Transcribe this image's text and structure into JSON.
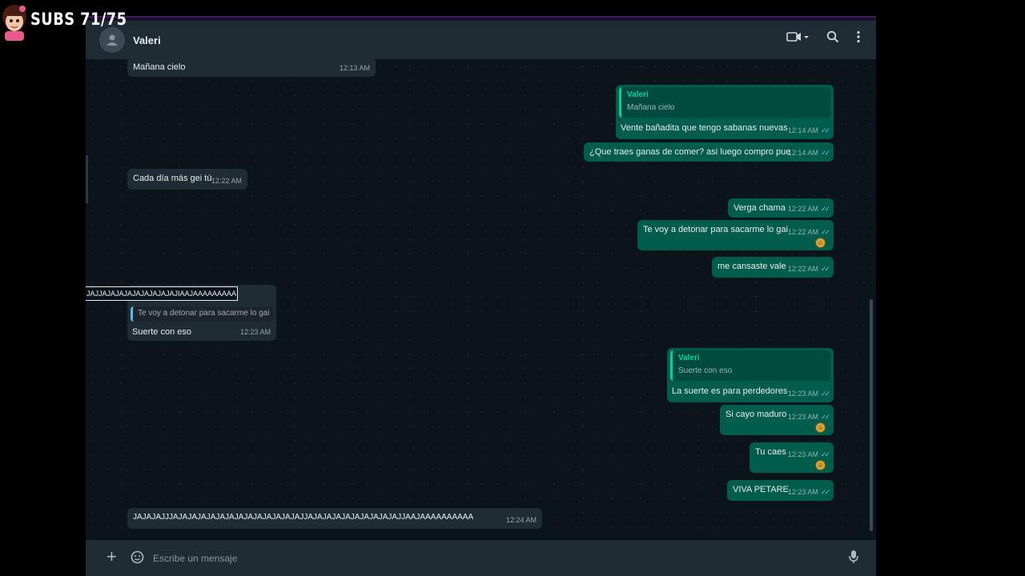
{
  "overlay": {
    "subs_text": "SUBS 71/75"
  },
  "header": {
    "contact_name": "Valeri",
    "icons": [
      "video-call-icon",
      "search-icon",
      "menu-icon"
    ]
  },
  "messages": [
    {
      "dir": "in",
      "text": "Mañana cielo",
      "time": "12:13 AM"
    },
    {
      "dir": "out",
      "quote_name": "Valeri",
      "quote_text": "Mañana cielo",
      "text": "Vente bañadita que tengo sabanas nuevas",
      "time": "12:14 AM"
    },
    {
      "dir": "out",
      "text": "¿Que traes ganas de comer? asi luego compro pue",
      "time": "12:14 AM"
    },
    {
      "dir": "in",
      "text": "Cada día más gei tú",
      "time": "12:22 AM"
    },
    {
      "dir": "out",
      "text": "Verga chama",
      "time": "12:22 AM"
    },
    {
      "dir": "out",
      "text": "Te voy a detonar para sacarme lo gai",
      "time": "12:22 AM",
      "reaction": "laugh-emoji"
    },
    {
      "dir": "out",
      "text": "me cansaste vale",
      "time": "12:22 AM"
    },
    {
      "dir": "in",
      "quote_name": "JAJJAJAJAJAJAJAJAJAJAJIAAJAAAAAAAAA",
      "quote_text": "Te voy a detonar para sacarme lo gai",
      "text": "Suerte con eso",
      "time": "12:23 AM"
    },
    {
      "dir": "out",
      "quote_name": "Valeri",
      "quote_text": "Suerte con eso",
      "text": "La suerte es para perdedores",
      "time": "12:23 AM"
    },
    {
      "dir": "out",
      "text": "Si cayo maduro",
      "time": "12:23 AM",
      "reaction": "laugh-emoji"
    },
    {
      "dir": "out",
      "text": "Tu caes",
      "time": "12:23 AM",
      "reaction": "laugh-emoji"
    },
    {
      "dir": "out",
      "text": "VIVA PETARE",
      "time": "12:23 AM"
    },
    {
      "dir": "in",
      "text": "JAJAJAJJJAJAJAJAJAJAJAJAJAJAJAJAJAJAJJAJAJAJAJAJAJAJAJAJAJJAAJAAAAAAAAAA",
      "time": "12:24 AM"
    }
  ],
  "composer": {
    "placeholder": "Escribe un mensaje"
  },
  "colors": {
    "incoming": "#202c33",
    "outgoing": "#005c4b",
    "background": "#0b141a",
    "accent": "#06cf9c",
    "ticks": "#53bdeb"
  }
}
